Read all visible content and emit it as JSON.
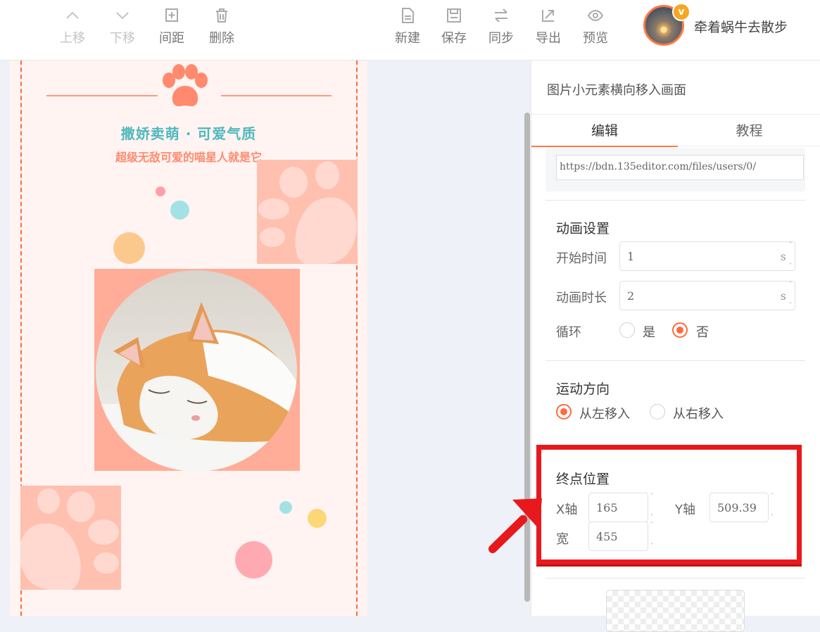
{
  "toolbar": {
    "up": "上移",
    "down": "下移",
    "spacing": "间距",
    "delete": "删除",
    "new": "新建",
    "save": "保存",
    "sync": "同步",
    "export": "导出",
    "preview": "预览"
  },
  "user": {
    "name": "牵着蜗牛去散步",
    "badge": "v"
  },
  "canvas": {
    "title": "撒娇卖萌 · 可爱气质",
    "subtitle": "超级无敌可爱的喵星人就是它"
  },
  "panel": {
    "title": "图片小元素横向移入画面",
    "tabs": [
      "编辑",
      "教程"
    ],
    "image_url": "https://bdn.135editor.com/files/users/0/",
    "animation": {
      "heading": "动画设置",
      "start_label": "开始时间",
      "start_value": "1",
      "duration_label": "动画时长",
      "duration_value": "2",
      "unit": "s",
      "loop_label": "循环",
      "loop_yes": "是",
      "loop_no": "否",
      "loop_selected": "否"
    },
    "direction": {
      "heading": "运动方向",
      "from_left": "从左移入",
      "from_right": "从右移入",
      "selected": "从左移入"
    },
    "end_position": {
      "heading": "终点位置",
      "x_label": "X轴",
      "x_value": "165",
      "y_label": "Y轴",
      "y_value": "509.39",
      "width_label": "宽",
      "width_value": "455"
    }
  },
  "colors": {
    "accent": "#ff6a3d",
    "title_teal": "#4fb8bd",
    "highlight_red": "#e8191d"
  }
}
